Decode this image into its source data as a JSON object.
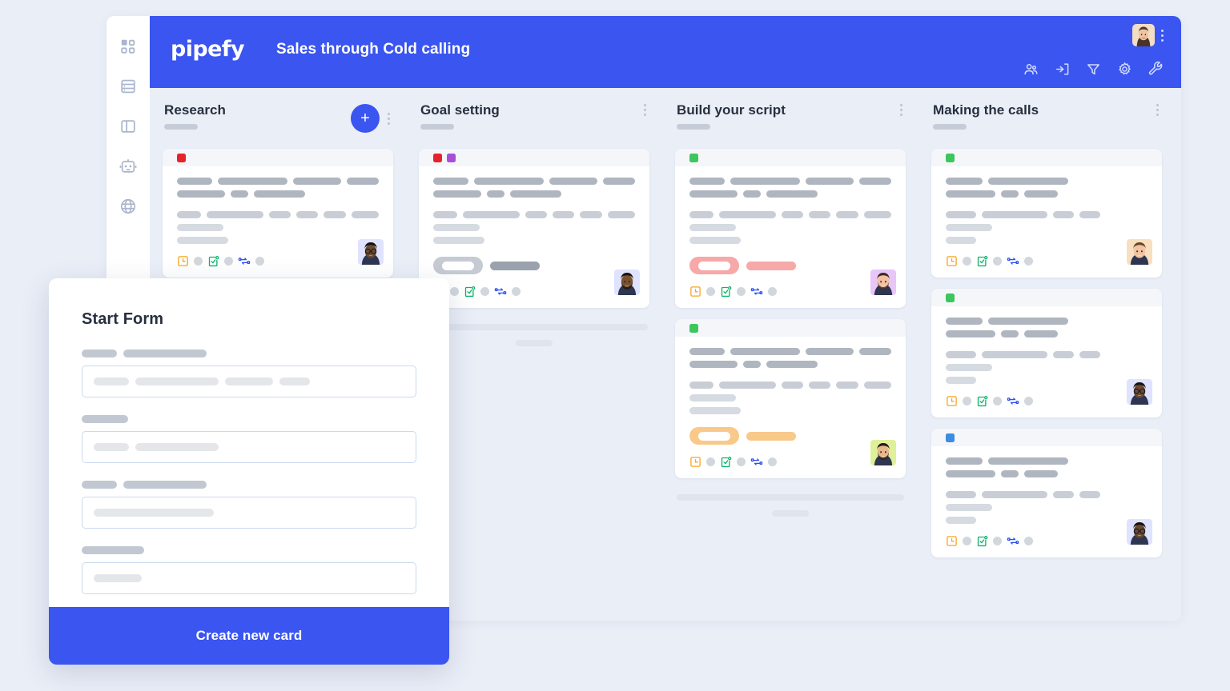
{
  "app": {
    "brand": "pipefy",
    "pipe_title": "Sales through Cold calling",
    "accent_color": "#3a55f0",
    "page_background": "#eaeef7"
  },
  "sidebar": {
    "items": [
      {
        "icon": "dashboard-grid-icon",
        "label": "Dashboard"
      },
      {
        "icon": "database-list-icon",
        "label": "Database"
      },
      {
        "icon": "layout-panel-icon",
        "label": "Layout"
      },
      {
        "icon": "robot-automation-icon",
        "label": "Automations"
      },
      {
        "icon": "globe-public-icon",
        "label": "Public"
      }
    ]
  },
  "topbar": {
    "user_avatar": "user-avatar",
    "kebab": "more-options",
    "tools": [
      {
        "icon": "members-icon",
        "label": "Members"
      },
      {
        "icon": "import-icon",
        "label": "Import"
      },
      {
        "icon": "filter-icon",
        "label": "Filter"
      },
      {
        "icon": "settings-icon",
        "label": "Settings"
      },
      {
        "icon": "wrench-icon",
        "label": "Tools"
      }
    ]
  },
  "board": {
    "columns": [
      {
        "title": "Research",
        "has_add_button": true,
        "add_label": "+",
        "cards": [
          {
            "tags": [
              "#e8222a"
            ],
            "badge": null,
            "avatar": "avatar-person-1",
            "icons": [
              "clock-orange-icon",
              "calendar-check-green-icon",
              "flow-blue-icon"
            ]
          }
        ],
        "ghost_footer": false
      },
      {
        "title": "Goal setting",
        "has_add_button": false,
        "cards": [
          {
            "tags": [
              "#e8222a",
              "#a84fd6"
            ],
            "badge": {
              "pill_color": "#c5cad3",
              "bar_color": "#9aa2ae"
            },
            "avatar": "avatar-person-2",
            "icons": [
              "clock-orange-icon",
              "calendar-check-green-icon",
              "flow-blue-icon"
            ]
          }
        ],
        "ghost_footer": true
      },
      {
        "title": "Build your script",
        "has_add_button": false,
        "cards": [
          {
            "tags": [
              "#3cc65c"
            ],
            "badge": {
              "pill_color": "#f7a8a8",
              "bar_color": "#f7a8a8"
            },
            "avatar": "avatar-person-3",
            "icons": [
              "clock-orange-icon",
              "calendar-check-green-icon",
              "flow-blue-icon"
            ]
          },
          {
            "tags": [
              "#3cc65c"
            ],
            "badge": {
              "pill_color": "#f9c98a",
              "bar_color": "#f9c98a"
            },
            "avatar": "avatar-person-4",
            "icons": [
              "clock-orange-icon",
              "calendar-check-green-icon",
              "flow-blue-icon"
            ]
          }
        ],
        "ghost_footer": true
      },
      {
        "title": "Making the calls",
        "has_add_button": false,
        "cards": [
          {
            "tags": [
              "#3cc65c"
            ],
            "badge": null,
            "avatar": "avatar-person-5",
            "icons": [
              "clock-orange-icon",
              "calendar-check-green-icon",
              "flow-blue-icon"
            ]
          },
          {
            "tags": [
              "#3cc65c"
            ],
            "badge": null,
            "avatar": "avatar-person-6",
            "icons": [
              "clock-orange-icon",
              "calendar-check-green-icon",
              "flow-blue-icon"
            ]
          },
          {
            "tags": [
              "#3a8de0"
            ],
            "badge": null,
            "avatar": "avatar-person-7",
            "icons": [
              "clock-orange-icon",
              "calendar-check-green-icon",
              "flow-blue-icon"
            ]
          }
        ],
        "ghost_footer": false
      }
    ]
  },
  "start_form": {
    "title": "Start Form",
    "submit_label": "Create new card",
    "fields": [
      {
        "label_widths": [
          44,
          104
        ],
        "placeholder_widths": [
          44,
          104,
          60,
          38
        ]
      },
      {
        "label_widths": [
          58
        ],
        "placeholder_widths": [
          44,
          104
        ]
      },
      {
        "label_widths": [
          44,
          104
        ],
        "placeholder_widths": [
          150
        ]
      },
      {
        "label_widths": [
          78
        ],
        "placeholder_widths": [
          60
        ]
      }
    ]
  }
}
